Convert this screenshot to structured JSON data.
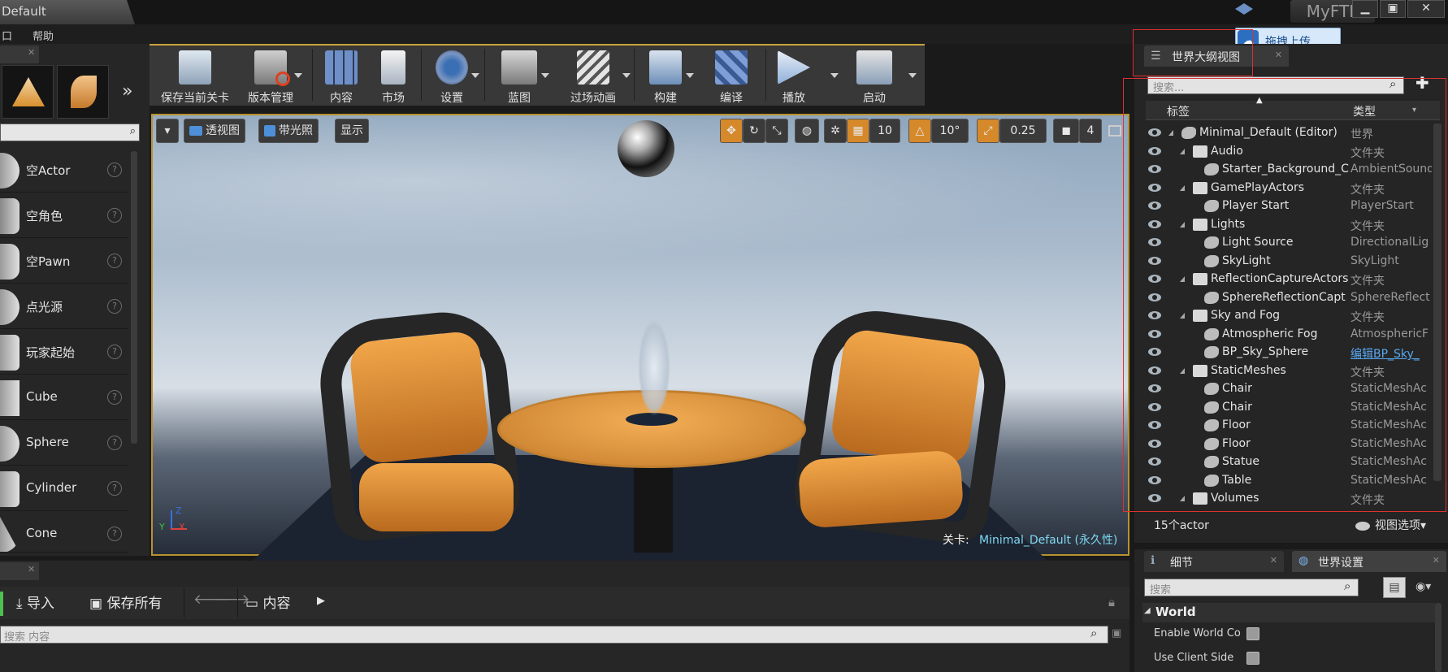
{
  "window": {
    "title": "Default",
    "ftp": "MyFTP",
    "min": "▁",
    "max": "▣",
    "close": "✕"
  },
  "menu": {
    "item1": "口",
    "help": "帮助"
  },
  "upload": {
    "label": "拖拽上传"
  },
  "palette": {
    "items": [
      {
        "label": "空Actor"
      },
      {
        "label": "空角色"
      },
      {
        "label": "空Pawn"
      },
      {
        "label": "点光源"
      },
      {
        "label": "玩家起始"
      },
      {
        "label": "Cube"
      },
      {
        "label": "Sphere"
      },
      {
        "label": "Cylinder"
      },
      {
        "label": "Cone"
      }
    ],
    "help": "?"
  },
  "toolbar": {
    "buttons": [
      {
        "label": "保存当前关卡"
      },
      {
        "label": "版本管理"
      },
      {
        "label": "内容"
      },
      {
        "label": "市场"
      },
      {
        "label": "设置"
      },
      {
        "label": "蓝图"
      },
      {
        "label": "过场动画"
      },
      {
        "label": "构建"
      },
      {
        "label": "编译"
      },
      {
        "label": "播放"
      },
      {
        "label": "启动"
      }
    ]
  },
  "viewport": {
    "perspective": "透视图",
    "lit": "带光照",
    "show": "显示",
    "grid_snap": "10",
    "rot_snap": "10°",
    "scale_snap": "0.25",
    "cam_speed": "4",
    "level_label": "关卡:",
    "level_name": "Minimal_Default (永久性)",
    "axis_z": "Z",
    "axis_x": "X",
    "axis_y": "Y"
  },
  "outliner": {
    "tab": "世界大纲视图",
    "search_placeholder": "搜索...",
    "col_label": "标签",
    "col_type": "类型",
    "rows": [
      {
        "name": "Minimal_Default (Editor)",
        "type": "世界"
      },
      {
        "name": "Audio",
        "type": "文件夹"
      },
      {
        "name": "Starter_Background_C",
        "type": "AmbientSound"
      },
      {
        "name": "GamePlayActors",
        "type": "文件夹"
      },
      {
        "name": "Player Start",
        "type": "PlayerStart"
      },
      {
        "name": "Lights",
        "type": "文件夹"
      },
      {
        "name": "Light Source",
        "type": "DirectionalLig"
      },
      {
        "name": "SkyLight",
        "type": "SkyLight"
      },
      {
        "name": "ReflectionCaptureActors",
        "type": "文件夹"
      },
      {
        "name": "SphereReflectionCapt",
        "type": "SphereReflect"
      },
      {
        "name": "Sky and Fog",
        "type": "文件夹"
      },
      {
        "name": "Atmospheric Fog",
        "type": "AtmosphericF"
      },
      {
        "name": "BP_Sky_Sphere",
        "type": "编辑BP_Sky_"
      },
      {
        "name": "StaticMeshes",
        "type": "文件夹"
      },
      {
        "name": "Chair",
        "type": "StaticMeshAc"
      },
      {
        "name": "Chair",
        "type": "StaticMeshAc"
      },
      {
        "name": "Floor",
        "type": "StaticMeshAc"
      },
      {
        "name": "Floor",
        "type": "StaticMeshAc"
      },
      {
        "name": "Statue",
        "type": "StaticMeshAc"
      },
      {
        "name": "Table",
        "type": "StaticMeshAc"
      },
      {
        "name": "Volumes",
        "type": "文件夹"
      }
    ],
    "count": "15个actor",
    "view_options": "视图选项▾"
  },
  "details": {
    "tab_details": "细节",
    "tab_world": "世界设置",
    "search_placeholder": "搜索",
    "section": "World",
    "props": [
      {
        "label": "Enable World Co"
      },
      {
        "label": "Use Client Side"
      }
    ]
  },
  "content_browser": {
    "import": "导入",
    "save_all": "保存所有",
    "path": "内容",
    "search_placeholder": "搜索 内容"
  }
}
